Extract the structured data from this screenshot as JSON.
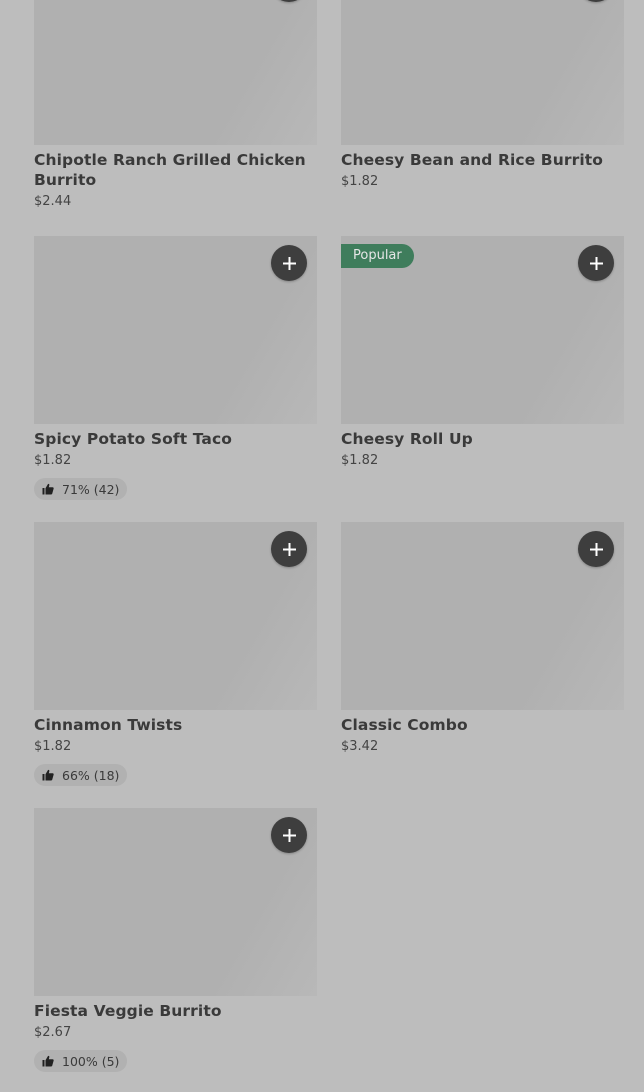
{
  "items": [
    {
      "name": "Chipotle Ranch Grilled Chicken Burrito",
      "price": "$2.44"
    },
    {
      "name": "Cheesy Bean and Rice Burrito",
      "price": "$1.82"
    },
    {
      "name": "Spicy Potato Soft Taco",
      "price": "$1.82",
      "rating": "71% (42)"
    },
    {
      "name": "Cheesy Roll Up",
      "price": "$1.82",
      "badge": "Popular"
    },
    {
      "name": "Cinnamon Twists",
      "price": "$1.82",
      "rating": "66% (18)"
    },
    {
      "name": "Classic Combo",
      "price": "$3.42"
    },
    {
      "name": "Fiesta Veggie Burrito",
      "price": "$2.67",
      "rating": "100% (5)"
    }
  ],
  "icons": {
    "add": "plus-icon",
    "thumbs_up": "thumbs-up-icon"
  },
  "colors": {
    "background": "#bdbdbd",
    "image_placeholder": "#b0b0b0",
    "button": "#3e3e3e",
    "badge": "#3f7d5c"
  }
}
